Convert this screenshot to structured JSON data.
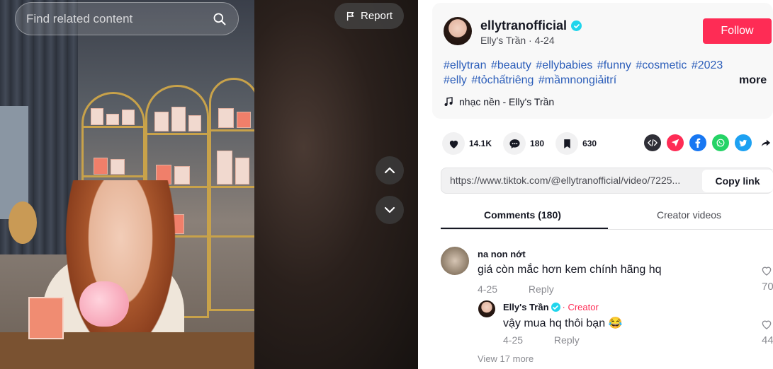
{
  "search": {
    "placeholder": "Find related content"
  },
  "video": {
    "report_label": "Report"
  },
  "author": {
    "username": "ellytranofficial",
    "display_name": "Elly's Trần",
    "date": "4-24",
    "follow_label": "Follow"
  },
  "description": {
    "hashtags": [
      "#ellytran",
      "#beauty",
      "#ellybabies",
      "#funny",
      "#cosmetic",
      "#2023",
      "#elly",
      "#tỏchấtriêng",
      "#mầmnongiảitrí"
    ],
    "more_label": "more",
    "music": "nhạc nền - Elly's Trần"
  },
  "stats": {
    "likes": "14.1K",
    "comments": "180",
    "saves": "630"
  },
  "share": {
    "link": "https://www.tiktok.com/@ellytranofficial/video/7225...",
    "copy_label": "Copy link",
    "icons": [
      "embed-icon",
      "send-icon",
      "facebook-icon",
      "whatsapp-icon",
      "twitter-icon",
      "share-arrow-icon"
    ]
  },
  "tabs": {
    "comments": "Comments (180)",
    "creator_videos": "Creator videos"
  },
  "comments": [
    {
      "name": "na non nớt",
      "text": "giá còn mắc hơn kem chính hãng hq",
      "date": "4-25",
      "reply_label": "Reply",
      "likes": "70",
      "replies": [
        {
          "name": "Elly's Trần",
          "creator_label": "Creator",
          "text": "vậy mua hq thôi bạn 😂",
          "date": "4-25",
          "reply_label": "Reply",
          "likes": "44"
        }
      ],
      "view_more": "View 17 more"
    }
  ],
  "colors": {
    "accent": "#fe2c55",
    "hashtag": "#2b5db9",
    "verified": "#20d5ec"
  }
}
